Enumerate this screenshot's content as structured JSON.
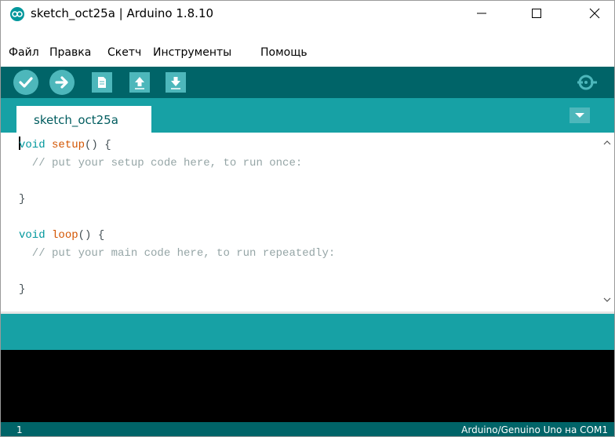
{
  "window": {
    "title": "sketch_oct25a | Arduino 1.8.10",
    "controls": {
      "minimize": "—",
      "maximize": "☐",
      "close": "✕"
    }
  },
  "menu": {
    "items": [
      "Файл",
      "Правка",
      "Скетч",
      "Инструменты",
      "Помощь"
    ]
  },
  "toolbar": {
    "buttons": [
      "verify-icon",
      "upload-icon",
      "new-icon",
      "open-icon",
      "save-icon",
      "serial-monitor-icon"
    ]
  },
  "tabs": [
    {
      "label": "sketch_oct25a"
    }
  ],
  "editor": {
    "lines": [
      {
        "kw": "void",
        "fn": "setup",
        "rest": "() {",
        "cm": ""
      },
      {
        "kw": "",
        "fn": "",
        "rest": "",
        "cm": "  // put your setup code here, to run once:"
      },
      {
        "kw": "",
        "fn": "",
        "rest": "",
        "cm": ""
      },
      {
        "kw": "",
        "fn": "",
        "rest": "}",
        "cm": ""
      },
      {
        "kw": "",
        "fn": "",
        "rest": "",
        "cm": ""
      },
      {
        "kw": "void",
        "fn": "loop",
        "rest": "() {",
        "cm": ""
      },
      {
        "kw": "",
        "fn": "",
        "rest": "",
        "cm": "  // put your main code here, to run repeatedly:"
      },
      {
        "kw": "",
        "fn": "",
        "rest": "",
        "cm": ""
      },
      {
        "kw": "",
        "fn": "",
        "rest": "}",
        "cm": ""
      }
    ]
  },
  "status": {
    "line_number": "1",
    "board": "Arduino/Genuino Uno на COM1"
  },
  "colors": {
    "toolbar": "#006468",
    "tabstrip": "#17a1a5",
    "button": "#4db7bb",
    "keyword": "#00979c",
    "function": "#d35400",
    "comment": "#95a5a6"
  }
}
